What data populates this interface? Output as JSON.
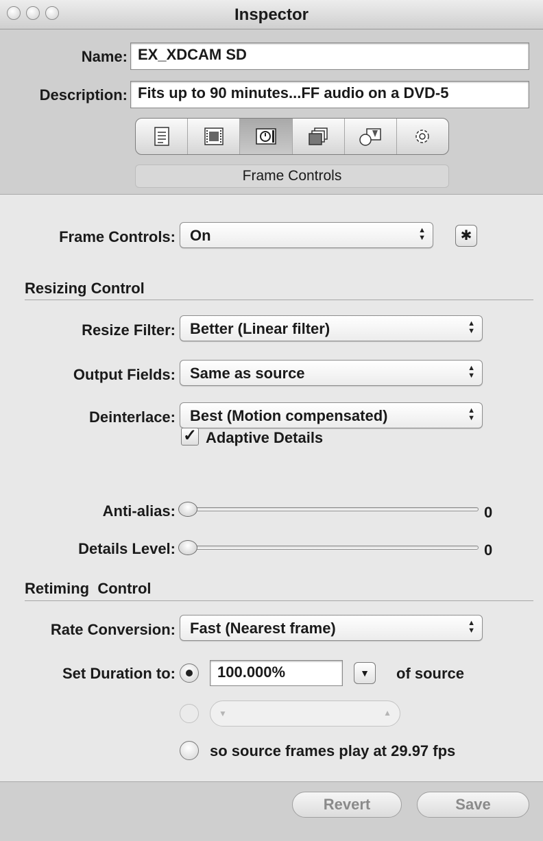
{
  "window": {
    "title": "Inspector"
  },
  "header": {
    "name_label": "Name:",
    "name_value": "EX_XDCAM SD",
    "description_label": "Description:",
    "description_value": "Fits up to 90 minutes...FF audio on a DVD-5",
    "tabs": [
      {
        "icon": "summary-icon",
        "selected": false
      },
      {
        "icon": "film-strip-icon",
        "selected": false
      },
      {
        "icon": "frame-controls-icon",
        "selected": true
      },
      {
        "icon": "layers-icon",
        "selected": false
      },
      {
        "icon": "shapes-icon",
        "selected": false
      },
      {
        "icon": "gear-icon",
        "selected": false
      }
    ],
    "selected_panel": "Frame Controls"
  },
  "frame_controls": {
    "label": "Frame Controls:",
    "value": "On"
  },
  "resizing": {
    "heading": "Resizing Control",
    "resize_filter_label": "Resize Filter:",
    "resize_filter_value": "Better (Linear filter)",
    "output_fields_label": "Output Fields:",
    "output_fields_value": "Same as source",
    "deinterlace_label": "Deinterlace:",
    "deinterlace_value": "Best (Motion compensated)",
    "adaptive_details_label": "Adaptive Details",
    "adaptive_details_checked": true,
    "anti_alias_label": "Anti-alias:",
    "anti_alias_value": "0",
    "details_level_label": "Details Level:",
    "details_level_value": "0"
  },
  "retiming": {
    "heading": "Retiming  Control",
    "rate_conversion_label": "Rate Conversion:",
    "rate_conversion_value": "Fast (Nearest frame)",
    "set_duration_label": "Set Duration to:",
    "duration_percent": "100.000%",
    "of_source": "of source",
    "option_3_label": "so source frames play at 29.97 fps",
    "selected_option": 1
  },
  "footer": {
    "revert_label": "Revert",
    "save_label": "Save"
  }
}
